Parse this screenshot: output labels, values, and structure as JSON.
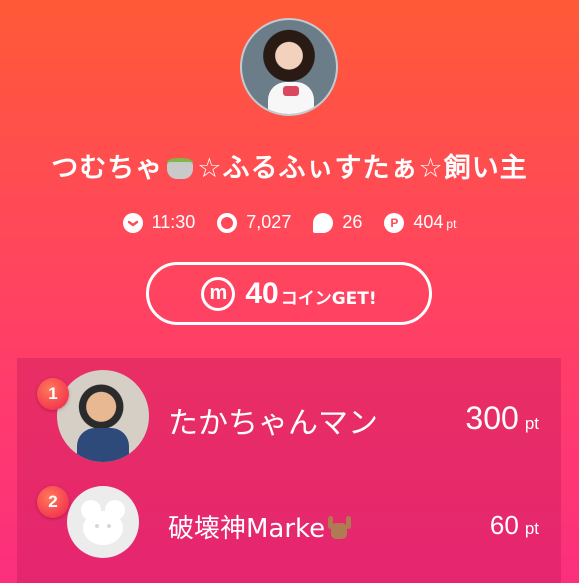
{
  "profile": {
    "name": "つむちゃ",
    "name_mid": "☆ふるふぃすたぁ☆飼い主",
    "emoji_icon": "green-tea-icon"
  },
  "stats": [
    {
      "icon": "clock-icon",
      "value": "11:30"
    },
    {
      "icon": "viewers-icon",
      "value": "7,027"
    },
    {
      "icon": "comment-icon",
      "value": "26"
    },
    {
      "icon": "points-icon",
      "value": "404",
      "unit": "pt"
    }
  ],
  "coin_button": {
    "icon_letter": "m",
    "amount": "40",
    "label": "コインGET!"
  },
  "ranking": [
    {
      "rank": "1",
      "name": "たかちゃんマン",
      "points": "300",
      "unit": "pt"
    },
    {
      "rank": "2",
      "name": "破壊神Marke",
      "points": "60",
      "unit": "pt"
    }
  ],
  "colors": {
    "gradient_top": "#ff5a37",
    "gradient_bottom": "#fb2f7c",
    "badge": "#f0204a"
  }
}
